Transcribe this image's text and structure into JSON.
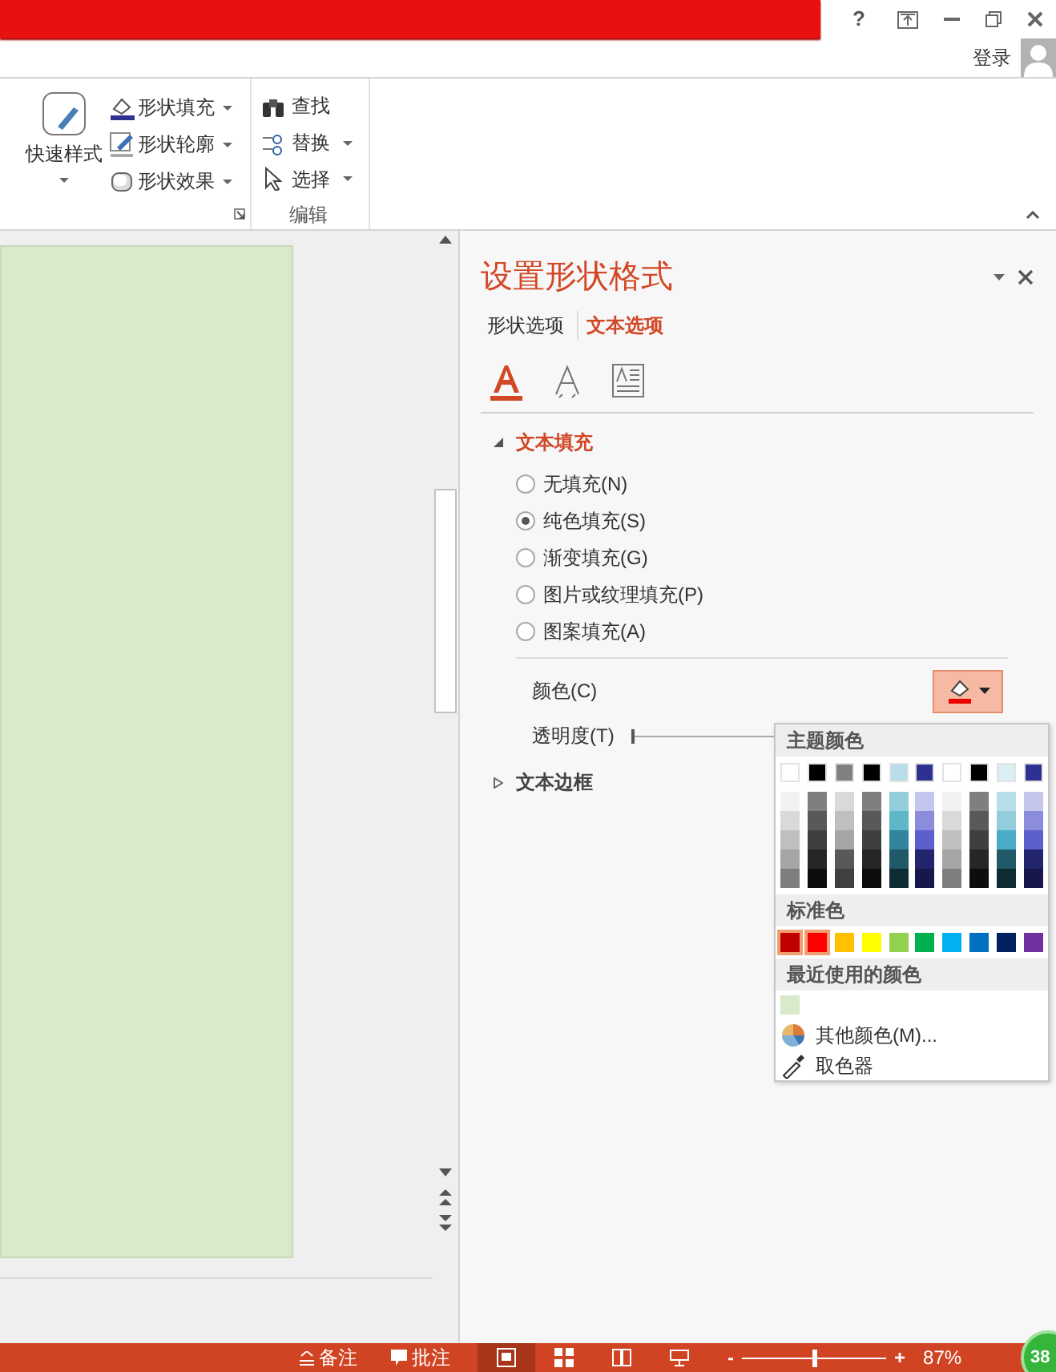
{
  "title_bar": {
    "help": "?"
  },
  "account": {
    "label": "登录"
  },
  "ribbon": {
    "quick_styles": "快速样式",
    "shape_commands": [
      {
        "kind": "fill",
        "label": "形状填充"
      },
      {
        "kind": "outline",
        "label": "形状轮廓"
      },
      {
        "kind": "effect",
        "label": "形状效果"
      }
    ],
    "edit_group": {
      "label": "编辑",
      "commands": [
        {
          "kind": "find",
          "label": "查找",
          "dropdown": false
        },
        {
          "kind": "replace",
          "label": "替换",
          "dropdown": true
        },
        {
          "kind": "select",
          "label": "选择",
          "dropdown": true
        }
      ]
    }
  },
  "pane": {
    "title": "设置形状格式",
    "tabs": [
      {
        "label": "形状选项",
        "selected": false
      },
      {
        "label": "文本选项",
        "selected": true
      }
    ],
    "icon_tabs": [
      {
        "kind": "fill",
        "selected": true
      },
      {
        "kind": "outline",
        "selected": false
      },
      {
        "kind": "textbox",
        "selected": false
      }
    ],
    "sections": [
      {
        "title": "文本填充",
        "expanded": true,
        "options": [
          {
            "label": "无填充(N)",
            "selected": false
          },
          {
            "label": "纯色填充(S)",
            "selected": true
          },
          {
            "label": "渐变填充(G)",
            "selected": false
          },
          {
            "label": "图片或纹理填充(P)",
            "selected": false
          },
          {
            "label": "图案填充(A)",
            "selected": false
          }
        ],
        "color_label": "颜色(C)",
        "transparency": {
          "label": "透明度(T)",
          "level": 0
        }
      },
      {
        "title": "文本边框",
        "expanded": false
      }
    ]
  },
  "color_menu": {
    "theme_title": "主题颜色",
    "theme_colors": [
      {
        "color": "#ffffff",
        "shades": [
          {
            "color": "#f2f2f2"
          },
          {
            "color": "#d9d9d9"
          },
          {
            "color": "#bfbfbf"
          },
          {
            "color": "#a6a6a6"
          },
          {
            "color": "#7f7f7f"
          }
        ]
      },
      {
        "color": "#000000",
        "shades": [
          {
            "color": "#7f7f7f"
          },
          {
            "color": "#595959"
          },
          {
            "color": "#3f3f3f"
          },
          {
            "color": "#262626"
          },
          {
            "color": "#0d0d0d"
          }
        ]
      },
      {
        "color": "#808080",
        "shades": [
          {
            "color": "#d9d9d9"
          },
          {
            "color": "#bfbfbf"
          },
          {
            "color": "#a6a6a6"
          },
          {
            "color": "#595959"
          },
          {
            "color": "#404040"
          }
        ]
      },
      {
        "color": "#000000",
        "shades": [
          {
            "color": "#7f7f7f"
          },
          {
            "color": "#595959"
          },
          {
            "color": "#3f3f3f"
          },
          {
            "color": "#262626"
          },
          {
            "color": "#0d0d0d"
          }
        ]
      },
      {
        "color": "#b7dee8",
        "shades": [
          {
            "color": "#92cddc"
          },
          {
            "color": "#5fb6c6"
          },
          {
            "color": "#31859c"
          },
          {
            "color": "#215968"
          },
          {
            "color": "#0f2c33"
          }
        ]
      },
      {
        "color": "#2e3192",
        "shades": [
          {
            "color": "#c5c6ee"
          },
          {
            "color": "#8b8ddc"
          },
          {
            "color": "#5c5fcc"
          },
          {
            "color": "#22246d"
          },
          {
            "color": "#171849"
          }
        ]
      },
      {
        "color": "#ffffff",
        "shades": [
          {
            "color": "#f2f2f2"
          },
          {
            "color": "#d9d9d9"
          },
          {
            "color": "#bfbfbf"
          },
          {
            "color": "#a6a6a6"
          },
          {
            "color": "#7f7f7f"
          }
        ]
      },
      {
        "color": "#000000",
        "shades": [
          {
            "color": "#7f7f7f"
          },
          {
            "color": "#595959"
          },
          {
            "color": "#3f3f3f"
          },
          {
            "color": "#262626"
          },
          {
            "color": "#0d0d0d"
          }
        ]
      },
      {
        "color": "#dbeef3",
        "shades": [
          {
            "color": "#b7dde8"
          },
          {
            "color": "#92cddc"
          },
          {
            "color": "#4aacc5"
          },
          {
            "color": "#215968"
          },
          {
            "color": "#0f2c33"
          }
        ]
      },
      {
        "color": "#2e3192",
        "shades": [
          {
            "color": "#c5c6ee"
          },
          {
            "color": "#8b8ddc"
          },
          {
            "color": "#5c5fcc"
          },
          {
            "color": "#22246d"
          },
          {
            "color": "#171849"
          }
        ]
      }
    ],
    "standard_title": "标准色",
    "standard_colors": [
      {
        "color": "#c00000",
        "selected": true
      },
      {
        "color": "#ff0000",
        "selected": true
      },
      {
        "color": "#ffc000",
        "selected": false
      },
      {
        "color": "#ffff00",
        "selected": false
      },
      {
        "color": "#92d050",
        "selected": false
      },
      {
        "color": "#00b050",
        "selected": false
      },
      {
        "color": "#00b0f0",
        "selected": false
      },
      {
        "color": "#0070c0",
        "selected": false
      },
      {
        "color": "#002060",
        "selected": false
      },
      {
        "color": "#7030a0",
        "selected": false
      }
    ],
    "recent_title": "最近使用的颜色",
    "recent_colors": [
      {
        "color": "#d9eacb"
      }
    ],
    "items": [
      {
        "kind": "more",
        "label": "其他颜色(M)..."
      },
      {
        "kind": "eyedropper",
        "label": "取色器"
      }
    ]
  },
  "status_bar": {
    "notes": "备注",
    "comments": "批注",
    "views": [
      {
        "kind": "normal",
        "selected": true
      },
      {
        "kind": "sorter",
        "selected": false
      },
      {
        "kind": "reading",
        "selected": false
      },
      {
        "kind": "slideshow",
        "selected": false
      }
    ],
    "zoom": {
      "minus": "-",
      "plus": "+",
      "level": 0.5,
      "percent": "87%"
    }
  },
  "badge": "38"
}
